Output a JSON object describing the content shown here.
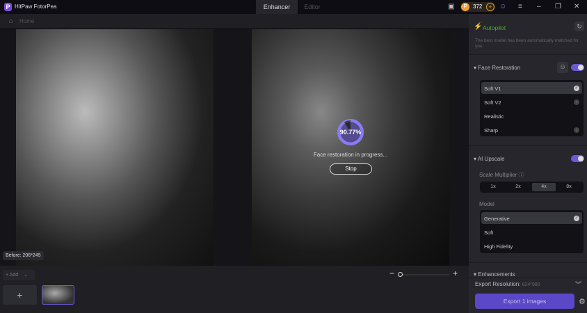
{
  "app": {
    "title": "HitPaw FotorPea",
    "logo_letter": "P"
  },
  "tabs": [
    {
      "label": "Enhancer",
      "active": true
    },
    {
      "label": "Editor",
      "active": false
    }
  ],
  "coins": {
    "count": "372"
  },
  "breadcrumb": {
    "home": "Home"
  },
  "canvas": {
    "before_label": "Before: 206*245",
    "progress": "90.77%",
    "progress_value": 90.77,
    "status": "Face restoration in progress...",
    "stop_label": "Stop"
  },
  "bottom": {
    "add_label": "+ Add"
  },
  "panel": {
    "autopilot": {
      "title": "Autopilot",
      "desc": "The best model has been automatically matched for you"
    },
    "face_restoration": {
      "title": "Face Restoration",
      "enabled": true,
      "options": [
        {
          "label": "Soft V1",
          "selected": true
        },
        {
          "label": "Soft V2"
        },
        {
          "label": "Realistic"
        },
        {
          "label": "Sharp"
        }
      ]
    },
    "ai_upscale": {
      "title": "AI Upscale",
      "enabled": true,
      "scale_label": "Scale Multiplier",
      "scales": [
        "1x",
        "2x",
        "4x",
        "8x"
      ],
      "selected_scale": "4x",
      "model_label": "Model",
      "models": [
        {
          "label": "Generative",
          "selected": true
        },
        {
          "label": "Soft"
        },
        {
          "label": "High Fidelity"
        }
      ]
    },
    "enhancements": {
      "title": "Enhancements"
    },
    "export_resolution_label": "Export Resolution:",
    "export_resolution": "824*980",
    "export_button": "Export 1 images"
  },
  "colors": {
    "accent": "#6a5ad8",
    "autopilot": "#4caf2a"
  }
}
